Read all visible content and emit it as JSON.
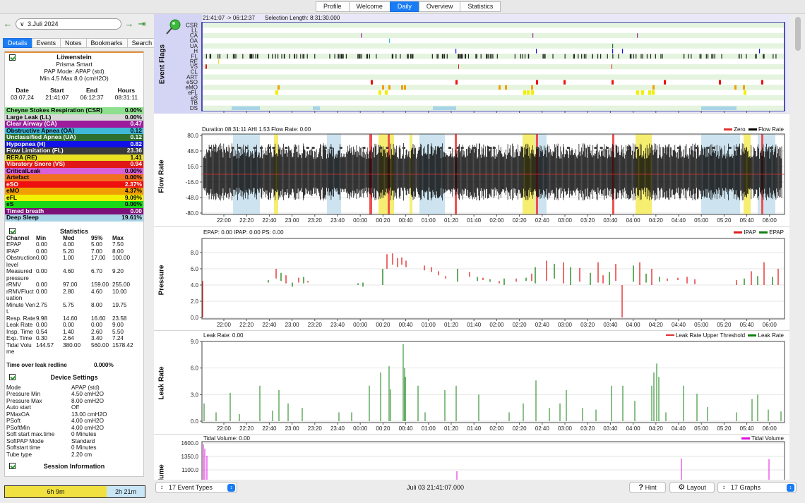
{
  "top_tabs": [
    "Profile",
    "Welcome",
    "Daily",
    "Overview",
    "Statistics"
  ],
  "active_tab": "Daily",
  "date_nav": {
    "date": "3.Juli 2024"
  },
  "left_tabs": [
    "Details",
    "Events",
    "Notes",
    "Bookmarks",
    "Search"
  ],
  "device": {
    "brand": "Löwenstein",
    "model": "Prisma Smart",
    "mode_line": "PAP Mode: APAP (std)",
    "pressure_line": "Min 4.5 Max 8.0 (cmH2O)"
  },
  "session_summary": {
    "headers": [
      "Date",
      "Start",
      "End",
      "Hours"
    ],
    "values": [
      "03.07.24",
      "21:41:07",
      "06:12:37",
      "08:31:11"
    ]
  },
  "events": [
    {
      "label": "Cheyne Stokes Respiration (CSR)",
      "value": "0.00%",
      "bg": "#8ee08e",
      "fg": "#000"
    },
    {
      "label": "Large Leak (LL)",
      "value": "0.00%",
      "bg": "#d8d8d8",
      "fg": "#000"
    },
    {
      "label": "Clear Airway (CA)",
      "value": "0.47",
      "bg": "#9c1c9c",
      "fg": "#fff"
    },
    {
      "label": "Obstructive Apnea (OA)",
      "value": "0.12",
      "bg": "#40b8d8",
      "fg": "#000"
    },
    {
      "label": "Unclassified Apnea (UA)",
      "value": "0.12",
      "bg": "#2e6e2e",
      "fg": "#fff"
    },
    {
      "label": "Hypopnea (H)",
      "value": "0.82",
      "bg": "#1010e8",
      "fg": "#fff"
    },
    {
      "label": "Flow Limitation (FL)",
      "value": "23.36",
      "bg": "#3a3a3a",
      "fg": "#fff"
    },
    {
      "label": "RERA (RE)",
      "value": "1.41",
      "bg": "#e8e020",
      "fg": "#000"
    },
    {
      "label": "Vibratory Snore (VS)",
      "value": "0.94",
      "bg": "#e01818",
      "fg": "#fff"
    },
    {
      "label": "CriticalLeak",
      "value": "0.00%",
      "bg": "#d860d8",
      "fg": "#000"
    },
    {
      "label": "Artefact",
      "value": "0.00%",
      "bg": "#f07020",
      "fg": "#000"
    },
    {
      "label": "eSO",
      "value": "2.37%",
      "bg": "#ee1010",
      "fg": "#fff"
    },
    {
      "label": "eMO",
      "value": "4.37%",
      "bg": "#f0a000",
      "fg": "#000"
    },
    {
      "label": "eFL",
      "value": "9.09%",
      "bg": "#f0f000",
      "fg": "#000"
    },
    {
      "label": "eS",
      "value": "0.00%",
      "bg": "#18d818",
      "fg": "#000"
    },
    {
      "label": "Timed breath",
      "value": "0.00",
      "bg": "#7c1078",
      "fg": "#fff"
    },
    {
      "label": "Deep Sleep",
      "value": "19.61%",
      "bg": "#a8d4e8",
      "fg": "#000"
    }
  ],
  "statistics": {
    "title": "Statistics",
    "headers": [
      "Channel",
      "Min",
      "Med",
      "95%",
      "Max"
    ],
    "rows": [
      [
        "EPAP",
        "0.00",
        "4.00",
        "5.00",
        "7.50"
      ],
      [
        "IPAP",
        "0.00",
        "5.20",
        "7.00",
        "8.00"
      ],
      [
        "Obstruction level",
        "0.00",
        "1.00",
        "17.00",
        "100.00"
      ],
      [
        "Measured pressure",
        "0.00",
        "4.60",
        "6.70",
        "9.20"
      ],
      [
        "rRMV",
        "0.00",
        "97.00",
        "159.00",
        "255.00"
      ],
      [
        "rRMVFluctuation",
        "0.00",
        "2.80",
        "4.60",
        "10.00"
      ],
      [
        "Minute Vent.",
        "2.75",
        "5.75",
        "8.00",
        "19.75"
      ],
      [
        "Resp. Rate",
        "9.98",
        "14.60",
        "16.60",
        "23.58"
      ],
      [
        "Leak Rate",
        "0.00",
        "0.00",
        "0.00",
        "9.00"
      ],
      [
        "Insp. Time",
        "0.54",
        "1.40",
        "2.60",
        "5.50"
      ],
      [
        "Exp. Time",
        "0.30",
        "2.64",
        "3.40",
        "7.24"
      ],
      [
        "Tidal Volume",
        "144.57",
        "380.00",
        "560.00",
        "1578.42"
      ]
    ],
    "leak_redline_label": "Time over leak redline",
    "leak_redline_value": "0.000%"
  },
  "device_settings": {
    "title": "Device Settings",
    "rows": [
      [
        "Mode",
        "APAP (std)"
      ],
      [
        "Pressure Min",
        "4.50 cmH2O"
      ],
      [
        "Pressure Max",
        "8.00 cmH2O"
      ],
      [
        "Auto start",
        "Off"
      ],
      [
        "PMaxOA",
        "13.00 cmH2O"
      ],
      [
        "PSoft",
        "4.00 cmH2O"
      ],
      [
        "PSoftMin",
        "4.00 cmH2O"
      ],
      [
        "Soft start max.time",
        "0 Minutes"
      ],
      [
        "SoftPAP Mode",
        "Standard"
      ],
      [
        "Softstart time",
        "0 Minutes"
      ],
      [
        "Tube type",
        "2.20 cm"
      ]
    ]
  },
  "session_info_title": "Session Information",
  "session_bar": {
    "left": "6h 9m",
    "right": "2h 21m"
  },
  "time_ticks": [
    "22:00",
    "22:20",
    "22:40",
    "23:00",
    "23:20",
    "23:40",
    "00:00",
    "00:20",
    "00:40",
    "01:00",
    "01:20",
    "01:40",
    "02:00",
    "02:20",
    "02:40",
    "03:00",
    "03:20",
    "03:40",
    "04:00",
    "04:20",
    "04:40",
    "05:00",
    "05:20",
    "05:40",
    "06:00"
  ],
  "event_flags": {
    "title": "Event Flags",
    "range": "21:41:07 -> 06:12:37",
    "selection": "Selection Length: 8:31:30.000",
    "rows": [
      "CSR",
      "LL",
      "CA",
      "OA",
      "UA",
      "H",
      "FL",
      "RE",
      "VS",
      "CL",
      "ART",
      "eSO",
      "eMO",
      "eFL",
      "eS",
      "TB",
      "DS"
    ]
  },
  "flow_rate": {
    "title": "Flow Rate",
    "info": "Duration 08:31:11 AHI 1.53 Flow Rate: 0.00",
    "legend": [
      "Zero",
      "Flow Rate"
    ],
    "yticks": [
      "80.0",
      "48.0",
      "16.0",
      "-16.0",
      "-48.0",
      "-80.0"
    ],
    "colors": {
      "zero": "#e03030",
      "flow": "#000000"
    }
  },
  "pressure": {
    "title": "Pressure",
    "info": "EPAP: 0.00 IPAP: 0.00 PS: 0.00",
    "legend": [
      "IPAP",
      "EPAP"
    ],
    "yticks": [
      "8.0",
      "6.0",
      "4.0",
      "2.0",
      "0.0"
    ],
    "colors": {
      "ipap": "#e02020",
      "epap": "#108010"
    }
  },
  "leak_rate": {
    "title": "Leak Rate",
    "info": "Leak Rate: 0.00",
    "legend": [
      "Leak Rate Upper Threshold",
      "Leak Rate"
    ],
    "yticks": [
      "9.0",
      "6.0",
      "3.0",
      "0.0"
    ],
    "colors": {
      "threshold": "#e03030",
      "leak": "#108010"
    }
  },
  "tidal_volume": {
    "title": "Volume",
    "info": "Tidal Volume: 0.00",
    "legend": [
      "Tidal Volume"
    ],
    "yticks": [
      "1600.0",
      "1350.0",
      "1100.0"
    ],
    "colors": {
      "tidal": "#e010e0"
    }
  },
  "footer": {
    "event_types": "17 Event Types",
    "timestamp": "Juli 03 21:41:07.000",
    "hint": "Hint",
    "layout": "Layout",
    "graphs": "17 Graphs"
  }
}
